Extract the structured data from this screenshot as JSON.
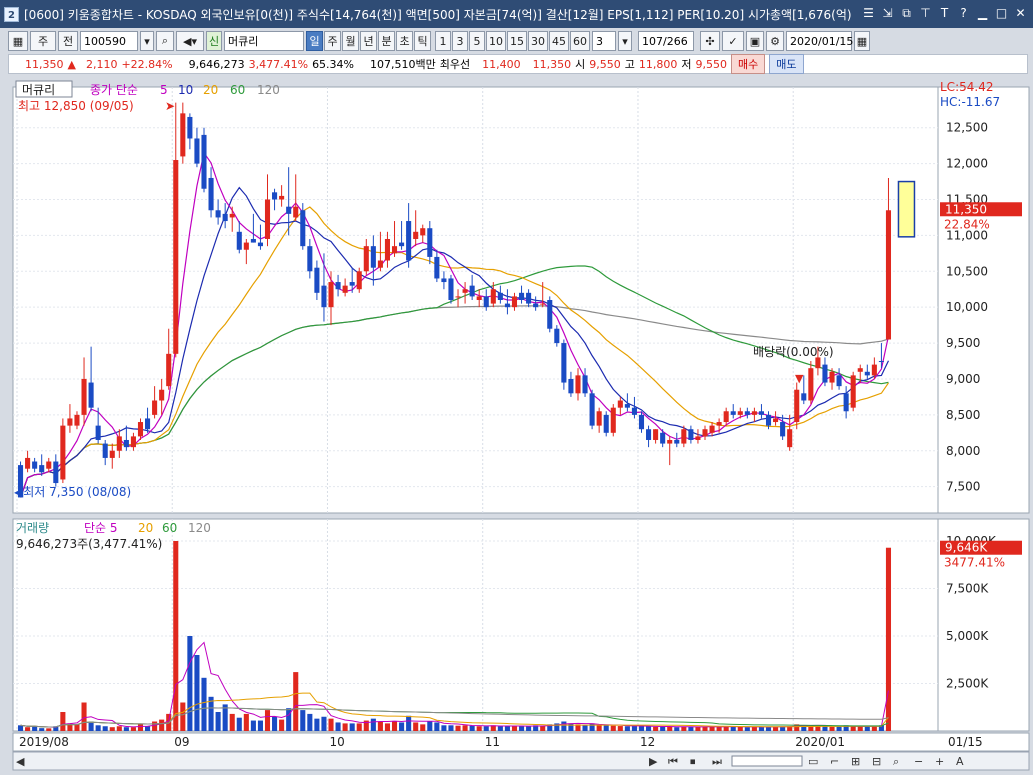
{
  "window": {
    "badge": "2",
    "title": "[0600] 키움종합차트 - KOSDAQ 외국인보유[0(천)] 주식수[14,764(천)] 액면[500] 자본금[74(억)] 결산[12월] EPS[1,112] PER[10.20] 시가총액[1,676(억)"
  },
  "toolbar": {
    "period_type": "주",
    "prev_label": "전",
    "code": "100590",
    "stock_badge": "신",
    "stock_name": "머큐리",
    "intervals": [
      "일",
      "주",
      "월",
      "년",
      "분",
      "초",
      "틱"
    ],
    "selected_interval": "일",
    "minute_options": [
      "1",
      "3",
      "5",
      "10",
      "15",
      "30",
      "45",
      "60"
    ],
    "count_value": "3",
    "page_indicator": "107/266",
    "date": "2020/01/15"
  },
  "quote": {
    "price": "11,350",
    "change": "2,110",
    "change_pct": "+22.84%",
    "volume": "9,646,273",
    "volume_ratio": "3,477.41%",
    "other_pct": "65.34%",
    "trade_amount": "107,510백만",
    "best_ask_label": "최우선",
    "best_ask": "11,400",
    "best_bid": "11,350",
    "open_label": "시",
    "open": "9,550",
    "high_label": "고",
    "high": "11,800",
    "low_label": "저",
    "low": "9,550",
    "buy_label": "매수",
    "sell_label": "매도"
  },
  "price_panel": {
    "legend_name": "머큐리",
    "legend_close": "종가 단순",
    "legend_ma": [
      "5",
      "10",
      "20",
      "60",
      "120"
    ],
    "ma_colors": {
      "5": "#c000c0",
      "10": "#1c2bb0",
      "20": "#e6a000",
      "60": "#2e9a3b",
      "120": "#8a8a8a"
    },
    "high_marker": "최고 12,850 (09/05)",
    "low_marker": "최저 7,350 (08/08)",
    "dividend_label": "배당락(0.00%)",
    "lc": "LC:54.42",
    "hc": "HC:-11.67",
    "current_price": "11,350",
    "current_pct": "22.84%",
    "y_ticks": [
      "12,500",
      "12,000",
      "11,500",
      "11,000",
      "10,500",
      "10,000",
      "9,500",
      "9,000",
      "8,500",
      "8,000",
      "7,500"
    ]
  },
  "volume_panel": {
    "legend_name": "거래량",
    "legend_ma_label": "단순",
    "legend_ma": [
      "5",
      "20",
      "60",
      "120"
    ],
    "volume_text": "9,646,273주(3,477.41%)",
    "current_volume": "9,646K",
    "current_pct": "3477.41%",
    "y_ticks": [
      "10,000K",
      "7,500K",
      "5,000K",
      "2,500K"
    ]
  },
  "x_axis": {
    "labels": [
      "2019/08",
      "09",
      "10",
      "11",
      "12",
      "2020/01",
      "01/15"
    ]
  },
  "chart_data": {
    "type": "candlestick",
    "price_unit": "KRW",
    "y_range": [
      7300,
      12900
    ],
    "volume_range_k": [
      0,
      10000
    ],
    "candles": [
      {
        "o": 7800,
        "h": 7850,
        "l": 7350,
        "c": 7350,
        "v": 300
      },
      {
        "o": 7750,
        "h": 8000,
        "l": 7700,
        "c": 7900,
        "v": 200
      },
      {
        "o": 7850,
        "h": 7900,
        "l": 7700,
        "c": 7750,
        "v": 250
      },
      {
        "o": 7800,
        "h": 7950,
        "l": 7650,
        "c": 7700,
        "v": 150
      },
      {
        "o": 7750,
        "h": 7900,
        "l": 7700,
        "c": 7850,
        "v": 140
      },
      {
        "o": 7850,
        "h": 7950,
        "l": 7500,
        "c": 7550,
        "v": 250
      },
      {
        "o": 7600,
        "h": 8450,
        "l": 7550,
        "c": 8350,
        "v": 1000
      },
      {
        "o": 8350,
        "h": 8650,
        "l": 8250,
        "c": 8450,
        "v": 400
      },
      {
        "o": 8350,
        "h": 8550,
        "l": 8300,
        "c": 8500,
        "v": 350
      },
      {
        "o": 8500,
        "h": 9300,
        "l": 8350,
        "c": 9000,
        "v": 1500
      },
      {
        "o": 8950,
        "h": 9450,
        "l": 8550,
        "c": 8600,
        "v": 500
      },
      {
        "o": 8350,
        "h": 8600,
        "l": 8100,
        "c": 8150,
        "v": 300
      },
      {
        "o": 8100,
        "h": 8150,
        "l": 7800,
        "c": 7900,
        "v": 250
      },
      {
        "o": 7900,
        "h": 8100,
        "l": 7750,
        "c": 8000,
        "v": 200
      },
      {
        "o": 8000,
        "h": 8300,
        "l": 7900,
        "c": 8200,
        "v": 250
      },
      {
        "o": 8150,
        "h": 8350,
        "l": 8000,
        "c": 8050,
        "v": 200
      },
      {
        "o": 8050,
        "h": 8250,
        "l": 8000,
        "c": 8200,
        "v": 200
      },
      {
        "o": 8200,
        "h": 8450,
        "l": 8150,
        "c": 8400,
        "v": 350
      },
      {
        "o": 8450,
        "h": 8600,
        "l": 8250,
        "c": 8300,
        "v": 250
      },
      {
        "o": 8500,
        "h": 8900,
        "l": 8450,
        "c": 8700,
        "v": 500
      },
      {
        "o": 8700,
        "h": 9000,
        "l": 8500,
        "c": 8850,
        "v": 600
      },
      {
        "o": 8900,
        "h": 9700,
        "l": 8850,
        "c": 9350,
        "v": 900
      },
      {
        "o": 9350,
        "h": 12850,
        "l": 9300,
        "c": 12050,
        "v": 10000
      },
      {
        "o": 12100,
        "h": 12850,
        "l": 12000,
        "c": 12700,
        "v": 1500
      },
      {
        "o": 12650,
        "h": 12700,
        "l": 12200,
        "c": 12350,
        "v": 5000
      },
      {
        "o": 12350,
        "h": 12500,
        "l": 11950,
        "c": 12000,
        "v": 4000
      },
      {
        "o": 12400,
        "h": 12500,
        "l": 11600,
        "c": 11650,
        "v": 2800
      },
      {
        "o": 11800,
        "h": 11950,
        "l": 11250,
        "c": 11350,
        "v": 1800
      },
      {
        "o": 11350,
        "h": 11500,
        "l": 11150,
        "c": 11250,
        "v": 1000
      },
      {
        "o": 11300,
        "h": 11450,
        "l": 11100,
        "c": 11200,
        "v": 1400
      },
      {
        "o": 11250,
        "h": 11400,
        "l": 11050,
        "c": 11300,
        "v": 900
      },
      {
        "o": 11050,
        "h": 11200,
        "l": 10750,
        "c": 10800,
        "v": 700
      },
      {
        "o": 10800,
        "h": 10950,
        "l": 10600,
        "c": 10900,
        "v": 900
      },
      {
        "o": 10950,
        "h": 11300,
        "l": 10900,
        "c": 10900,
        "v": 550
      },
      {
        "o": 10900,
        "h": 11150,
        "l": 10800,
        "c": 10850,
        "v": 550
      },
      {
        "o": 10950,
        "h": 11850,
        "l": 10850,
        "c": 11500,
        "v": 1100
      },
      {
        "o": 11600,
        "h": 11650,
        "l": 11350,
        "c": 11500,
        "v": 750
      },
      {
        "o": 11500,
        "h": 11700,
        "l": 11400,
        "c": 11550,
        "v": 600
      },
      {
        "o": 11400,
        "h": 11950,
        "l": 11000,
        "c": 11300,
        "v": 1200
      },
      {
        "o": 11250,
        "h": 11850,
        "l": 11200,
        "c": 11400,
        "v": 3100
      },
      {
        "o": 11350,
        "h": 11450,
        "l": 10800,
        "c": 10850,
        "v": 1100
      },
      {
        "o": 10850,
        "h": 10950,
        "l": 10400,
        "c": 10500,
        "v": 900
      },
      {
        "o": 10550,
        "h": 10650,
        "l": 10100,
        "c": 10200,
        "v": 650
      },
      {
        "o": 10300,
        "h": 10750,
        "l": 9800,
        "c": 10000,
        "v": 750
      },
      {
        "o": 10000,
        "h": 10500,
        "l": 9750,
        "c": 10350,
        "v": 650
      },
      {
        "o": 10350,
        "h": 10450,
        "l": 10150,
        "c": 10250,
        "v": 450
      },
      {
        "o": 10200,
        "h": 10400,
        "l": 10150,
        "c": 10300,
        "v": 400
      },
      {
        "o": 10350,
        "h": 10550,
        "l": 10200,
        "c": 10300,
        "v": 400
      },
      {
        "o": 10250,
        "h": 10550,
        "l": 10200,
        "c": 10500,
        "v": 400
      },
      {
        "o": 10500,
        "h": 10950,
        "l": 10450,
        "c": 10850,
        "v": 550
      },
      {
        "o": 10850,
        "h": 11000,
        "l": 10300,
        "c": 10550,
        "v": 650
      },
      {
        "o": 10550,
        "h": 11050,
        "l": 10500,
        "c": 10650,
        "v": 500
      },
      {
        "o": 10650,
        "h": 11050,
        "l": 10550,
        "c": 10950,
        "v": 400
      },
      {
        "o": 10750,
        "h": 11200,
        "l": 10700,
        "c": 10850,
        "v": 500
      },
      {
        "o": 10900,
        "h": 11200,
        "l": 10800,
        "c": 10850,
        "v": 450
      },
      {
        "o": 11200,
        "h": 11450,
        "l": 10550,
        "c": 10650,
        "v": 800
      },
      {
        "o": 10950,
        "h": 11350,
        "l": 10850,
        "c": 11050,
        "v": 450
      },
      {
        "o": 11000,
        "h": 11150,
        "l": 10900,
        "c": 11100,
        "v": 350
      },
      {
        "o": 11100,
        "h": 11200,
        "l": 10600,
        "c": 10700,
        "v": 500
      },
      {
        "o": 10700,
        "h": 10800,
        "l": 10350,
        "c": 10400,
        "v": 450
      },
      {
        "o": 10400,
        "h": 10500,
        "l": 10250,
        "c": 10350,
        "v": 300
      },
      {
        "o": 10400,
        "h": 10450,
        "l": 10050,
        "c": 10100,
        "v": 300
      },
      {
        "o": 10150,
        "h": 10250,
        "l": 10000,
        "c": 10150,
        "v": 280
      },
      {
        "o": 10200,
        "h": 10350,
        "l": 10050,
        "c": 10250,
        "v": 300
      },
      {
        "o": 10300,
        "h": 10450,
        "l": 10100,
        "c": 10150,
        "v": 280
      },
      {
        "o": 10100,
        "h": 10250,
        "l": 10000,
        "c": 10150,
        "v": 250
      },
      {
        "o": 10150,
        "h": 10250,
        "l": 9950,
        "c": 10000,
        "v": 250
      },
      {
        "o": 10050,
        "h": 10350,
        "l": 10000,
        "c": 10250,
        "v": 300
      },
      {
        "o": 10200,
        "h": 10300,
        "l": 10050,
        "c": 10100,
        "v": 250
      },
      {
        "o": 10050,
        "h": 10250,
        "l": 9900,
        "c": 10000,
        "v": 280
      },
      {
        "o": 10000,
        "h": 10200,
        "l": 9950,
        "c": 10150,
        "v": 250
      },
      {
        "o": 10200,
        "h": 10300,
        "l": 10050,
        "c": 10100,
        "v": 250
      },
      {
        "o": 10200,
        "h": 10250,
        "l": 10000,
        "c": 10050,
        "v": 250
      },
      {
        "o": 10050,
        "h": 10150,
        "l": 9950,
        "c": 10000,
        "v": 300
      },
      {
        "o": 10050,
        "h": 10350,
        "l": 10000,
        "c": 10050,
        "v": 280
      },
      {
        "o": 10100,
        "h": 10150,
        "l": 9650,
        "c": 9700,
        "v": 350
      },
      {
        "o": 9700,
        "h": 9750,
        "l": 9450,
        "c": 9500,
        "v": 400
      },
      {
        "o": 9500,
        "h": 9550,
        "l": 8850,
        "c": 8950,
        "v": 500
      },
      {
        "o": 9000,
        "h": 9100,
        "l": 8750,
        "c": 8800,
        "v": 400
      },
      {
        "o": 8800,
        "h": 9150,
        "l": 8700,
        "c": 9050,
        "v": 350
      },
      {
        "o": 9050,
        "h": 9150,
        "l": 8750,
        "c": 8800,
        "v": 300
      },
      {
        "o": 8800,
        "h": 8850,
        "l": 8300,
        "c": 8350,
        "v": 400
      },
      {
        "o": 8350,
        "h": 8600,
        "l": 8250,
        "c": 8550,
        "v": 300
      },
      {
        "o": 8500,
        "h": 8550,
        "l": 8200,
        "c": 8250,
        "v": 300
      },
      {
        "o": 8250,
        "h": 8650,
        "l": 8200,
        "c": 8600,
        "v": 280
      },
      {
        "o": 8600,
        "h": 8750,
        "l": 8500,
        "c": 8700,
        "v": 260
      },
      {
        "o": 8650,
        "h": 8800,
        "l": 8550,
        "c": 8600,
        "v": 250
      },
      {
        "o": 8600,
        "h": 8750,
        "l": 8450,
        "c": 8500,
        "v": 260
      },
      {
        "o": 8500,
        "h": 8550,
        "l": 8250,
        "c": 8300,
        "v": 250
      },
      {
        "o": 8300,
        "h": 8350,
        "l": 8050,
        "c": 8150,
        "v": 250
      },
      {
        "o": 8150,
        "h": 8300,
        "l": 8100,
        "c": 8300,
        "v": 220
      },
      {
        "o": 8250,
        "h": 8300,
        "l": 8050,
        "c": 8100,
        "v": 220
      },
      {
        "o": 8100,
        "h": 8200,
        "l": 7800,
        "c": 8150,
        "v": 230
      },
      {
        "o": 8150,
        "h": 8250,
        "l": 8050,
        "c": 8100,
        "v": 200
      },
      {
        "o": 8100,
        "h": 8350,
        "l": 8050,
        "c": 8300,
        "v": 240
      },
      {
        "o": 8300,
        "h": 8350,
        "l": 8100,
        "c": 8150,
        "v": 220
      },
      {
        "o": 8150,
        "h": 8300,
        "l": 8100,
        "c": 8200,
        "v": 210
      },
      {
        "o": 8200,
        "h": 8350,
        "l": 8150,
        "c": 8300,
        "v": 230
      },
      {
        "o": 8250,
        "h": 8400,
        "l": 8200,
        "c": 8350,
        "v": 220
      },
      {
        "o": 8350,
        "h": 8450,
        "l": 8250,
        "c": 8400,
        "v": 220
      },
      {
        "o": 8400,
        "h": 8600,
        "l": 8350,
        "c": 8550,
        "v": 250
      },
      {
        "o": 8550,
        "h": 8650,
        "l": 8450,
        "c": 8500,
        "v": 230
      },
      {
        "o": 8500,
        "h": 8600,
        "l": 8450,
        "c": 8550,
        "v": 210
      },
      {
        "o": 8550,
        "h": 8600,
        "l": 8450,
        "c": 8500,
        "v": 200
      },
      {
        "o": 8500,
        "h": 8600,
        "l": 8400,
        "c": 8550,
        "v": 210
      },
      {
        "o": 8550,
        "h": 8650,
        "l": 8450,
        "c": 8500,
        "v": 220
      },
      {
        "o": 8500,
        "h": 8550,
        "l": 8300,
        "c": 8350,
        "v": 230
      },
      {
        "o": 8400,
        "h": 8550,
        "l": 8350,
        "c": 8450,
        "v": 220
      },
      {
        "o": 8400,
        "h": 8500,
        "l": 8150,
        "c": 8200,
        "v": 240
      },
      {
        "o": 8050,
        "h": 8500,
        "l": 8000,
        "c": 8300,
        "v": 250
      },
      {
        "o": 8400,
        "h": 8950,
        "l": 8300,
        "c": 8850,
        "v": 350
      },
      {
        "o": 8800,
        "h": 9050,
        "l": 8650,
        "c": 8700,
        "v": 300
      },
      {
        "o": 8700,
        "h": 9250,
        "l": 8650,
        "c": 9150,
        "v": 300
      },
      {
        "o": 9150,
        "h": 9450,
        "l": 9050,
        "c": 9300,
        "v": 280
      },
      {
        "o": 9200,
        "h": 9300,
        "l": 8900,
        "c": 8950,
        "v": 250
      },
      {
        "o": 8950,
        "h": 9150,
        "l": 8850,
        "c": 9100,
        "v": 220
      },
      {
        "o": 9050,
        "h": 9150,
        "l": 8850,
        "c": 8900,
        "v": 220
      },
      {
        "o": 8800,
        "h": 8900,
        "l": 8450,
        "c": 8550,
        "v": 300
      },
      {
        "o": 8600,
        "h": 9100,
        "l": 8550,
        "c": 9050,
        "v": 260
      },
      {
        "o": 9100,
        "h": 9200,
        "l": 8950,
        "c": 9150,
        "v": 230
      },
      {
        "o": 9100,
        "h": 9200,
        "l": 9000,
        "c": 9050,
        "v": 220
      },
      {
        "o": 9050,
        "h": 9300,
        "l": 9000,
        "c": 9200,
        "v": 230
      },
      {
        "o": 9250,
        "h": 9500,
        "l": 9150,
        "c": 9240,
        "v": 300
      },
      {
        "o": 9550,
        "h": 11800,
        "l": 9550,
        "c": 11350,
        "v": 9646
      }
    ],
    "ma_series": [
      {
        "name": "5",
        "color": "#c000c0"
      },
      {
        "name": "10",
        "color": "#1c2bb0"
      },
      {
        "name": "20",
        "color": "#e6a000"
      },
      {
        "name": "60",
        "color": "#2e9a3b"
      },
      {
        "name": "120",
        "color": "#8a8a8a"
      }
    ]
  }
}
